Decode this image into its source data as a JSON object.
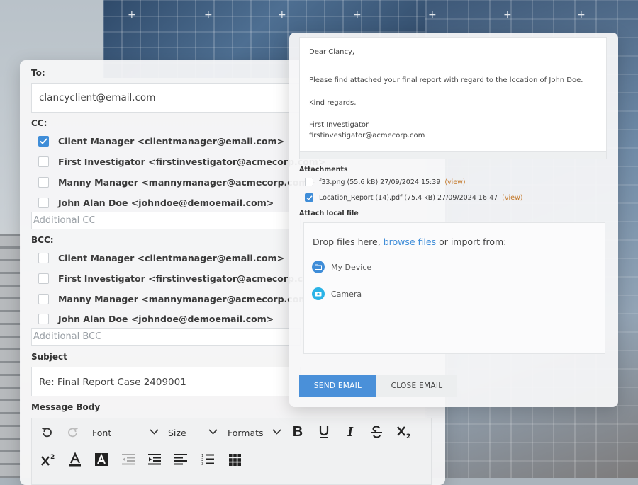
{
  "compose": {
    "to_label": "To:",
    "to_value": "clancyclient@email.com",
    "cc_label": "CC:",
    "cc_recipients": [
      {
        "label": "Client Manager <clientmanager@email.com>",
        "checked": true
      },
      {
        "label": "First Investigator <firstinvestigator@acmecorp.com>",
        "checked": false
      },
      {
        "label": "Manny Manager <mannymanager@acmecorp.com>",
        "checked": false
      },
      {
        "label": "John Alan Doe <johndoe@demoemail.com>",
        "checked": false
      }
    ],
    "additional_cc_placeholder": "Additional CC",
    "bcc_label": "BCC:",
    "bcc_recipients": [
      {
        "label": "Client Manager <clientmanager@email.com>",
        "checked": false
      },
      {
        "label": "First Investigator <firstinvestigator@acmecorp.com>",
        "checked": false
      },
      {
        "label": "Manny Manager <mannymanager@acmecorp.com>",
        "checked": false
      },
      {
        "label": "John Alan Doe <johndoe@demoemail.com>",
        "checked": false
      }
    ],
    "additional_bcc_placeholder": "Additional BCC",
    "subject_label": "Subject",
    "subject_value": "Re: Final Report Case 2409001",
    "message_body_label": "Message Body"
  },
  "editor_toolbar": {
    "font_label": "Font",
    "size_label": "Size",
    "formats_label": "Formats",
    "icons": [
      "undo-icon",
      "redo-icon",
      "bold-icon",
      "underline-icon",
      "italic-icon",
      "strikethrough-icon",
      "subscript-icon",
      "superscript-icon",
      "text-color-icon",
      "background-color-icon",
      "outdent-icon",
      "indent-icon",
      "align-left-icon",
      "numbered-list-icon",
      "table-icon"
    ]
  },
  "message": {
    "greeting": "Dear Clancy,",
    "line1": "Please find attached your final report with regard to the location of John Doe.",
    "closing": "Kind regards,",
    "signature_name": "First Investigator",
    "signature_email": "firstinvestigator@acmecorp.com"
  },
  "attachments": {
    "label": "Attachments",
    "items": [
      {
        "name": "f33.png (55.6 kB) 27/09/2024 15:39",
        "view": "(view)",
        "checked": false
      },
      {
        "name": "Location_Report (14).pdf (75.4 kB) 27/09/2024 16:47",
        "view": "(view)",
        "checked": true
      }
    ]
  },
  "attach_local": {
    "label": "Attach local file",
    "drop_prefix": "Drop files here, ",
    "browse_link": "browse files",
    "drop_suffix": " or import from:",
    "sources": [
      "My Device",
      "Camera"
    ]
  },
  "actions": {
    "send": "SEND EMAIL",
    "close": "CLOSE EMAIL"
  },
  "colors": {
    "accent": "#3f8dd8",
    "send_button": "#4a90d9",
    "view_link": "#c47a2c",
    "camera_icon": "#2bb3e6"
  }
}
